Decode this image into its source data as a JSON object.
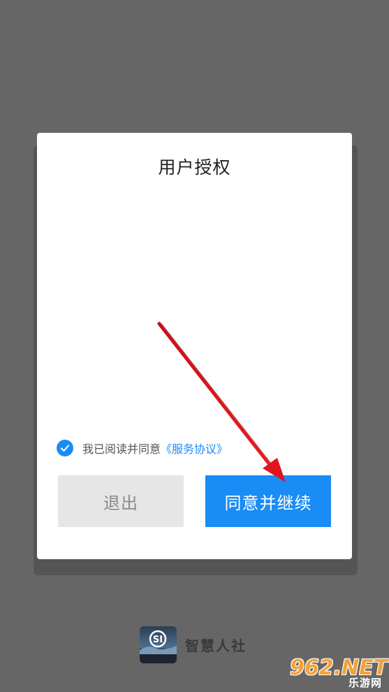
{
  "dialog": {
    "title": "用户授权",
    "agreement_text": "我已阅读并同意",
    "agreement_link": "《服务协议》",
    "agreement_checked": true,
    "exit_label": "退出",
    "agree_label": "同意并继续"
  },
  "brand": {
    "name": "智慧人社",
    "logo_text": "SI"
  },
  "watermark": {
    "main": "962.NET",
    "sub": "乐游网"
  },
  "colors": {
    "overlay": "#666666",
    "accent": "#1a8cf5",
    "exit_bg": "#e6e6e6",
    "annotation_arrow": "#e0141e"
  }
}
